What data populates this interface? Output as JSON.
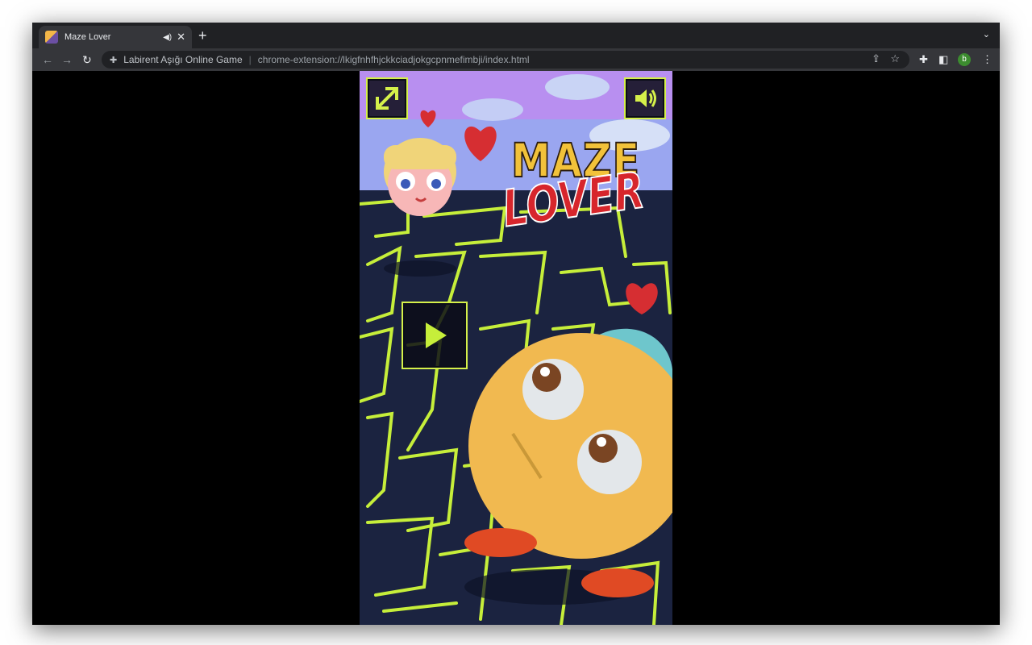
{
  "browser": {
    "tab": {
      "title": "Maze Lover",
      "audio_icon": "speaker-icon",
      "close_icon": "close-icon"
    },
    "new_tab_icon": "plus-icon",
    "tab_menu_icon": "chevron-down-icon",
    "address_bar": {
      "site_name": "Labirent Aşığı Online Game",
      "url": "chrome-extension://lkigfnhfhjckkciadjokgcpnmefimbji/index.html"
    },
    "profile_initial": "b",
    "colors": {
      "tabstrip": "#202124",
      "toolbar": "#35363a",
      "profile": "#3c8c2f"
    }
  },
  "game": {
    "logo_line1": "MAZE",
    "logo_line2": "LOVER",
    "buttons": {
      "fullscreen_icon": "expand-arrows-icon",
      "sound_icon": "speaker-icon",
      "play_icon": "play-triangle-icon"
    },
    "colors": {
      "maze_line": "#c6ee3a",
      "maze_bg": "#1b2340",
      "sky": "#9aa6f0",
      "button_border": "#d5f04a",
      "logo_yellow": "#f2c23a",
      "logo_red": "#d7262c"
    }
  }
}
